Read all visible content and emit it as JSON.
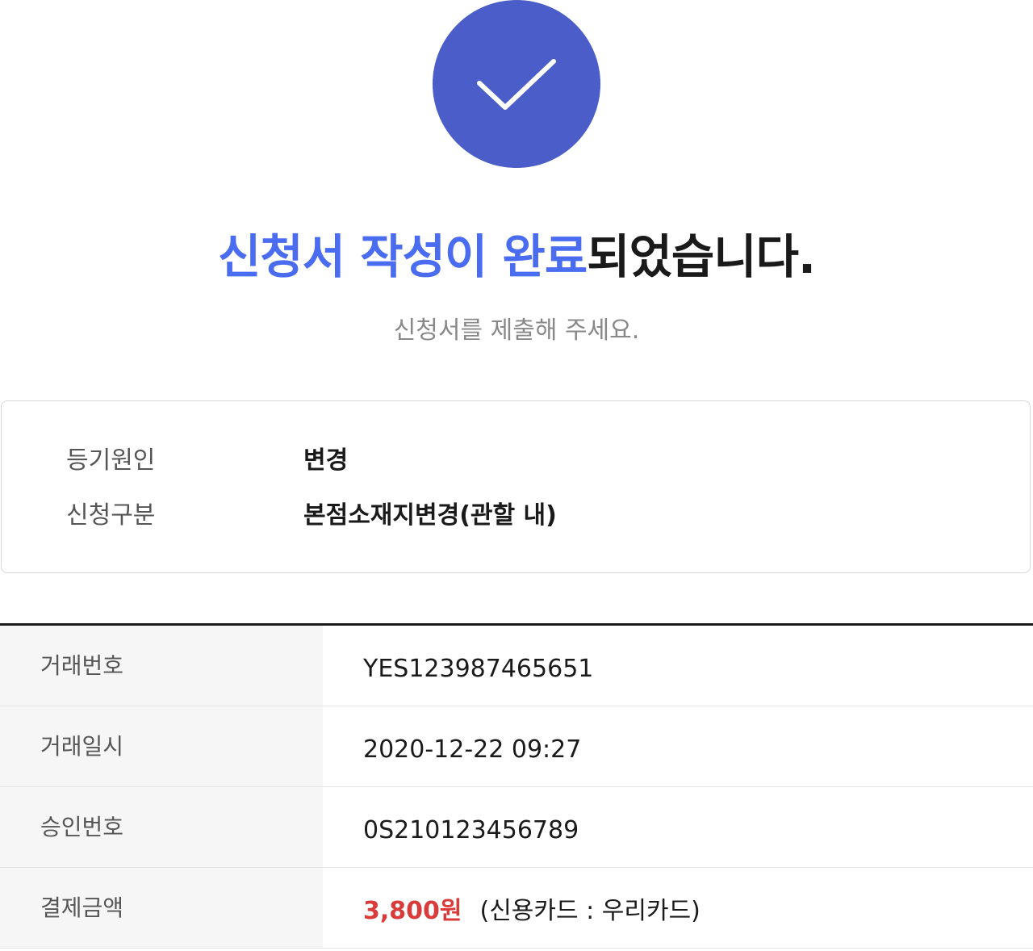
{
  "colors": {
    "brand_circle": "#4a5dc8",
    "headline_accent": "#4a6cf0",
    "amount_red": "#d93a3a"
  },
  "status_icon": "check-icon",
  "headline": {
    "accent": "신청서 작성이 완료",
    "rest": "되었습니다."
  },
  "subline": "신청서를 제출해 주세요.",
  "info": [
    {
      "key": "등기원인",
      "value": "변경"
    },
    {
      "key": "신청구분",
      "value": "본점소재지변경(관할 내)"
    }
  ],
  "details": {
    "transaction_no": {
      "label": "거래번호",
      "value": "YES123987465651"
    },
    "transaction_time": {
      "label": "거래일시",
      "value": "2020-12-22 09:27"
    },
    "approval_no": {
      "label": "승인번호",
      "value": "0S210123456789"
    },
    "payment": {
      "label": "결제금액",
      "amount": "3,800원",
      "method": "(신용카드 : 우리카드)"
    }
  }
}
